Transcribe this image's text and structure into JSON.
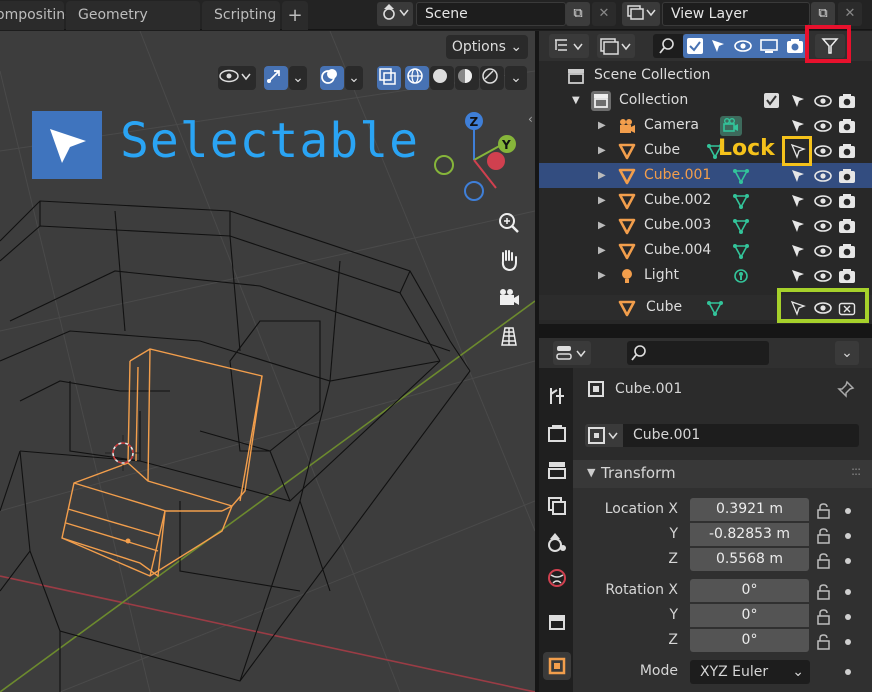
{
  "topbar": {
    "tabs": [
      "ompositing",
      "Geometry Nodes",
      "Scripting",
      "+"
    ],
    "scene_label": "Scene",
    "view_layer_label": "View Layer"
  },
  "viewport": {
    "options_label": "Options",
    "overlay_title": "Selectable"
  },
  "outliner": {
    "scene_collection": "Scene Collection",
    "collection": "Collection",
    "items": [
      {
        "label": "Camera"
      },
      {
        "label": "Cube"
      },
      {
        "label": "Cube.001"
      },
      {
        "label": "Cube.002"
      },
      {
        "label": "Cube.003"
      },
      {
        "label": "Cube.004"
      },
      {
        "label": "Light"
      }
    ],
    "extra_item": "Cube",
    "lock_annotation": "Lock"
  },
  "properties": {
    "object_name": "Cube.001",
    "object_field": "Cube.001",
    "panel_title": "Transform",
    "location_label_x": "Location X",
    "label_y": "Y",
    "label_z": "Z",
    "location": [
      "0.3921 m",
      "-0.82853 m",
      "0.5568 m"
    ],
    "rotation_label_x": "Rotation X",
    "rotation": [
      "0°",
      "0°",
      "0°"
    ],
    "mode_label": "Mode",
    "mode_value": "XYZ Euler"
  },
  "colors": {
    "selection_blue": "#334d80",
    "accent_blue": "#4772b3",
    "object_orange": "#f29e4c",
    "mesh_green": "#33c49a",
    "lock_yellow": "#f5c21b",
    "filter_red": "#e8112d",
    "highlight_green": "#a6d12b"
  }
}
